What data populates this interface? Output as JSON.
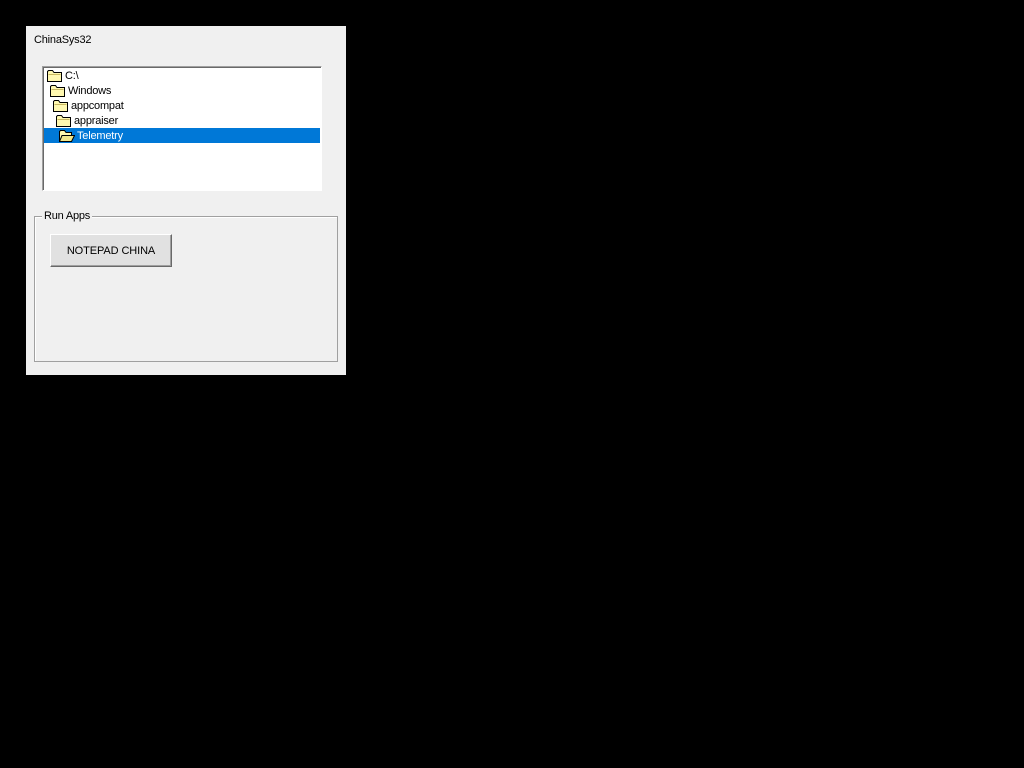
{
  "window": {
    "title": "ChinaSys32"
  },
  "tree": {
    "items": [
      {
        "label": "C:\\",
        "icon": "folder-icon",
        "selected": false
      },
      {
        "label": "Windows",
        "icon": "folder-icon",
        "selected": false
      },
      {
        "label": "appcompat",
        "icon": "folder-icon",
        "selected": false
      },
      {
        "label": "appraiser",
        "icon": "folder-icon",
        "selected": false
      },
      {
        "label": "Telemetry",
        "icon": "folder-open-icon",
        "selected": true
      }
    ]
  },
  "run_apps": {
    "legend": "Run Apps",
    "notepad_button_label": "NOTEPAD CHINA"
  },
  "colors": {
    "desktop": "#000000",
    "window_bg": "#f0f0f0",
    "selection": "#0078d7",
    "folder": "#f0e68c"
  }
}
